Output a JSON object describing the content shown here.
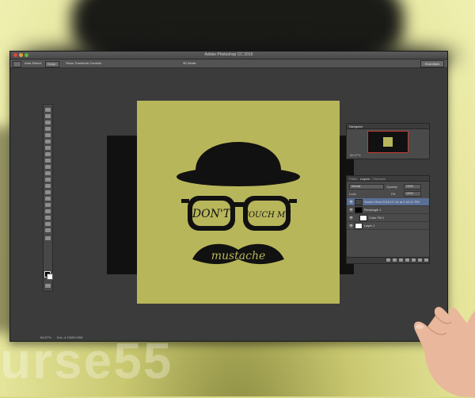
{
  "app": {
    "title": "Adobe Photoshop CC 2015",
    "workspace": "Essentials"
  },
  "options_bar": {
    "auto_select_label": "Auto-Select:",
    "auto_select_value": "Group",
    "transform_controls_label": "Show Transform Controls",
    "mode_3d_label": "3D Mode:"
  },
  "document": {
    "zoom": "66.67%",
    "doc_size": "Doc: 4.12M/9.00M"
  },
  "artwork": {
    "top_text_left": "DON'T",
    "top_text_right": "TOUCH MY",
    "bottom_text": "mustache",
    "canvas_color": "#b8b65a"
  },
  "navigator": {
    "tabs": [
      "Navigator"
    ],
    "zoom": "66.67%"
  },
  "layers_panel": {
    "tabs": [
      "Paths",
      "Layers",
      "Channels"
    ],
    "kind_label": "Normal",
    "opacity_label": "Opacity:",
    "opacity_value": "100%",
    "lock_label": "Lock:",
    "fill_label": "Fill:",
    "fill_value": "100%",
    "layers": [
      {
        "name": "Screen Shot 2015-07-16 at 2.40.21 PM",
        "selected": true,
        "thumb": "#444"
      },
      {
        "name": "Rectangle 1",
        "selected": false,
        "thumb": "#000"
      },
      {
        "name": "Color Fill 1",
        "selected": false,
        "thumb": "#fff"
      },
      {
        "name": "Layer 1",
        "selected": false,
        "thumb": "#fff"
      }
    ]
  },
  "watermark": "urse55"
}
